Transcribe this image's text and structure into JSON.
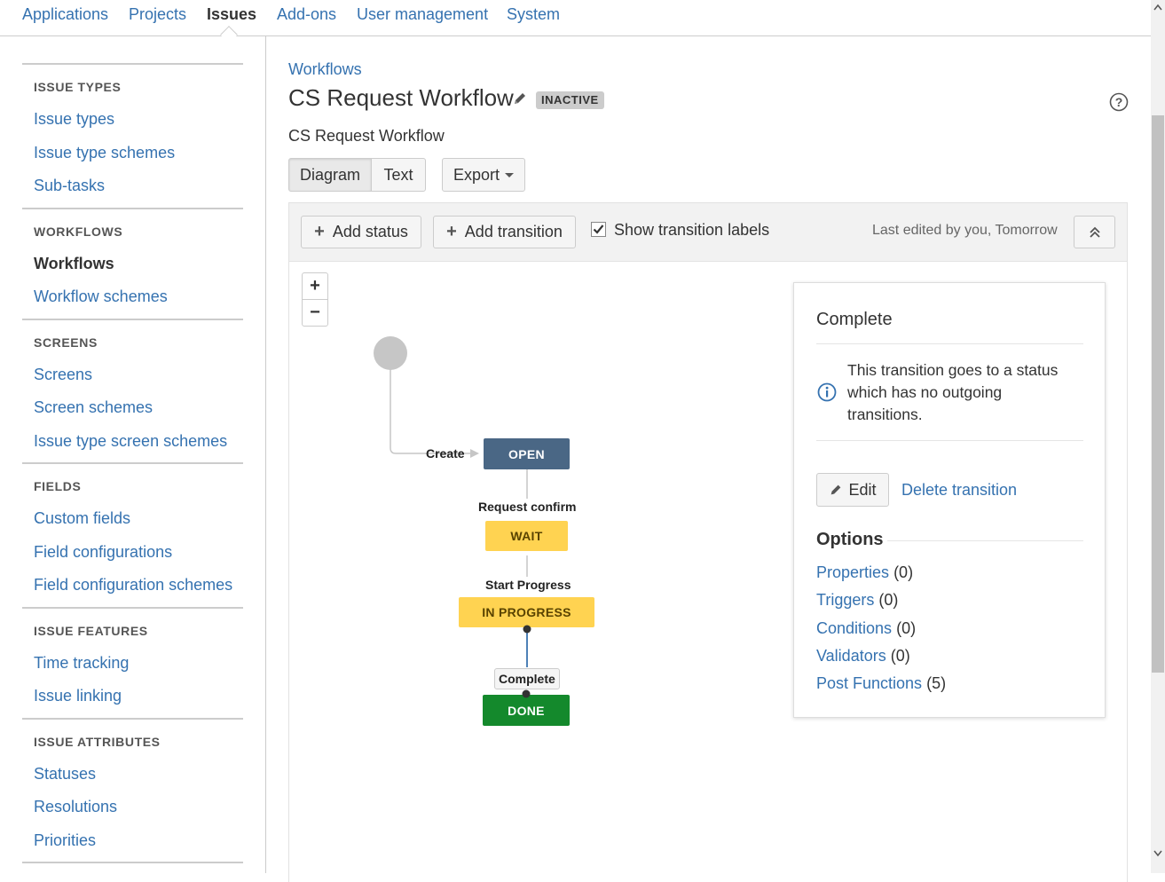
{
  "topnav": {
    "tabs": [
      {
        "label": "Applications"
      },
      {
        "label": "Projects"
      },
      {
        "label": "Issues"
      },
      {
        "label": "Add-ons"
      },
      {
        "label": "User management"
      },
      {
        "label": "System"
      }
    ],
    "active": "Issues"
  },
  "sidebar": {
    "sections": [
      {
        "heading": "ISSUE TYPES",
        "items": [
          "Issue types",
          "Issue type schemes",
          "Sub-tasks"
        ]
      },
      {
        "heading": "WORKFLOWS",
        "items": [
          "Workflows",
          "Workflow schemes"
        ]
      },
      {
        "heading": "SCREENS",
        "items": [
          "Screens",
          "Screen schemes",
          "Issue type screen schemes"
        ]
      },
      {
        "heading": "FIELDS",
        "items": [
          "Custom fields",
          "Field configurations",
          "Field configuration schemes"
        ]
      },
      {
        "heading": "ISSUE FEATURES",
        "items": [
          "Time tracking",
          "Issue linking"
        ]
      },
      {
        "heading": "ISSUE ATTRIBUTES",
        "items": [
          "Statuses",
          "Resolutions",
          "Priorities"
        ]
      }
    ],
    "active_item": "Workflows"
  },
  "main": {
    "breadcrumb": "Workflows",
    "title": "CS Request Workflow",
    "status_lozenge": "INACTIVE",
    "description": "CS Request Workflow",
    "view_tabs": {
      "diagram": "Diagram",
      "text": "Text",
      "selected": "Diagram"
    },
    "export_label": "Export",
    "toolbar": {
      "add_status": "Add status",
      "add_transition": "Add transition",
      "show_labels": "Show transition labels",
      "show_labels_checked": true,
      "last_edited": "Last edited by you, Tomorrow"
    },
    "zoom": {
      "in": "+",
      "out": "−"
    }
  },
  "diagram": {
    "statuses": {
      "open": "OPEN",
      "wait": "WAIT",
      "in_progress": "IN PROGRESS",
      "done": "DONE"
    },
    "transitions": {
      "create": "Create",
      "request_confirm": "Request confirm",
      "start_progress": "Start Progress",
      "complete": "Complete"
    },
    "colors": {
      "open": "#4a6785",
      "wait": "#ffd351",
      "in_progress": "#ffd351",
      "done": "#14892c",
      "selected_edge": "#3b73af"
    }
  },
  "panel": {
    "title": "Complete",
    "message": "This transition goes to a status which has no outgoing transitions.",
    "edit": "Edit",
    "delete": "Delete transition",
    "options_heading": "Options",
    "options": [
      {
        "label": "Properties",
        "count": "(0)"
      },
      {
        "label": "Triggers",
        "count": "(0)"
      },
      {
        "label": "Conditions",
        "count": "(0)"
      },
      {
        "label": "Validators",
        "count": "(0)"
      },
      {
        "label": "Post Functions",
        "count": "(5)"
      }
    ]
  }
}
